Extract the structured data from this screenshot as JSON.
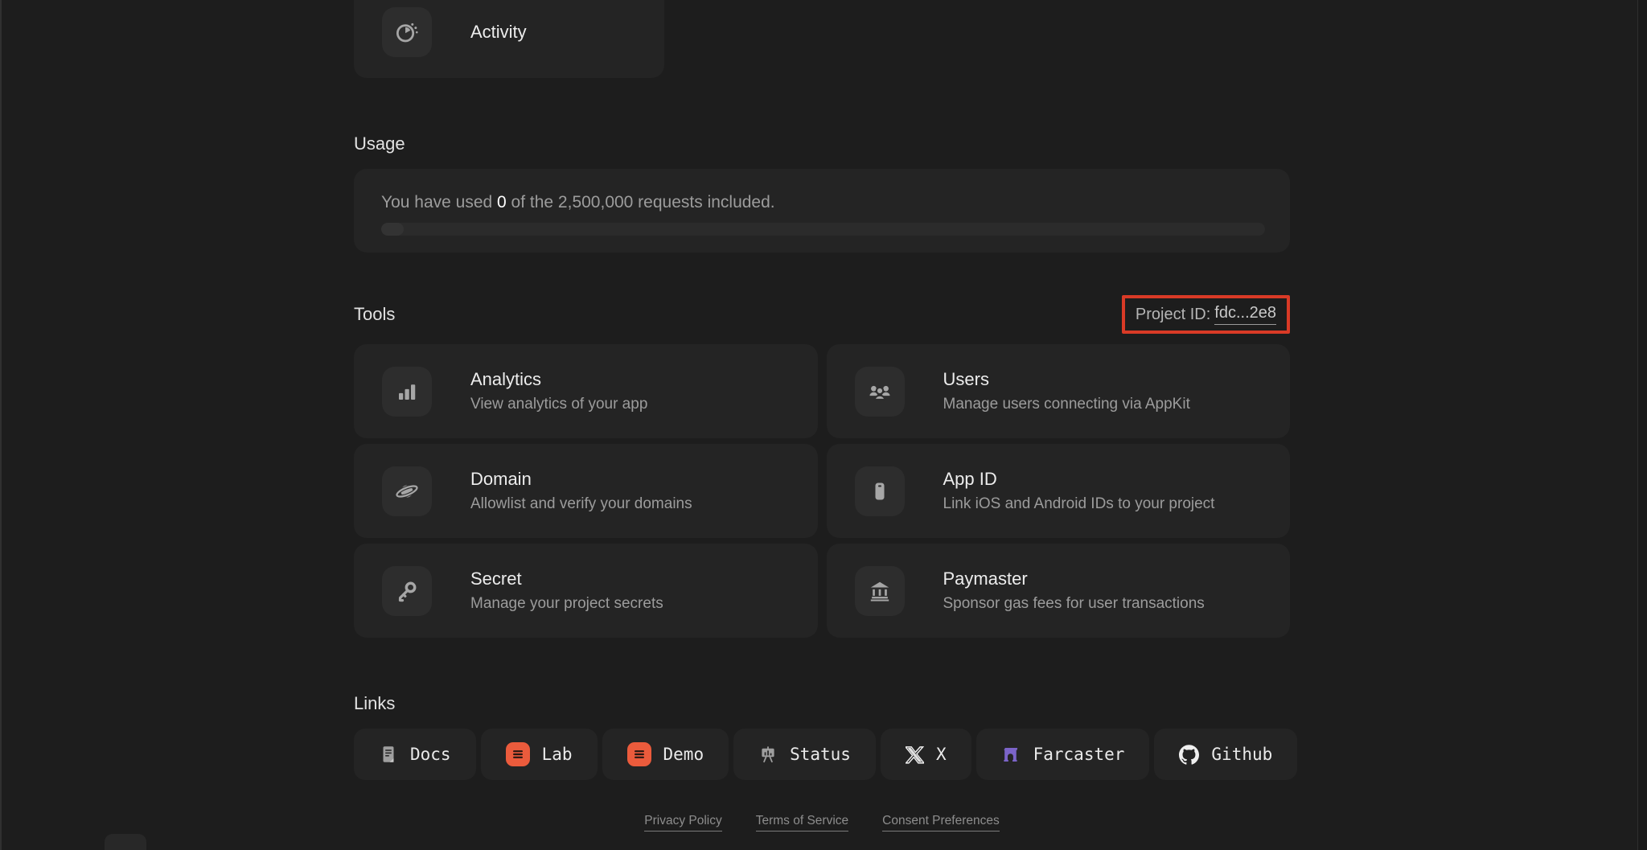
{
  "activity_card": {
    "label": "Activity"
  },
  "usage": {
    "heading": "Usage",
    "text_prefix": "You have used ",
    "used_value": "0",
    "text_suffix": " of the 2,500,000 requests included.",
    "progress_percent": 0
  },
  "tools": {
    "heading": "Tools",
    "project_id": {
      "label": "Project ID:",
      "value": "fdc...2e8",
      "highlight_color": "#d93a26"
    },
    "cards": [
      {
        "icon": "bar-chart-icon",
        "title": "Analytics",
        "description": "View analytics of your app"
      },
      {
        "icon": "users-icon",
        "title": "Users",
        "description": "Manage users connecting via AppKit"
      },
      {
        "icon": "planet-icon",
        "title": "Domain",
        "description": "Allowlist and verify your domains"
      },
      {
        "icon": "phone-icon",
        "title": "App ID",
        "description": "Link iOS and Android IDs to your project"
      },
      {
        "icon": "key-icon",
        "title": "Secret",
        "description": "Manage your project secrets"
      },
      {
        "icon": "bank-icon",
        "title": "Paymaster",
        "description": "Sponsor gas fees for user transactions"
      }
    ]
  },
  "links": {
    "heading": "Links",
    "items": [
      {
        "icon": "docs-icon",
        "label": "Docs"
      },
      {
        "icon": "lab-icon",
        "label": "Lab",
        "icon_color": "#eb5b3c"
      },
      {
        "icon": "demo-icon",
        "label": "Demo",
        "icon_color": "#eb5b3c"
      },
      {
        "icon": "status-icon",
        "label": "Status"
      },
      {
        "icon": "x-icon",
        "label": "X"
      },
      {
        "icon": "farcaster-icon",
        "label": "Farcaster",
        "icon_color": "#7b64c8"
      },
      {
        "icon": "github-icon",
        "label": "Github"
      }
    ]
  },
  "footer": {
    "links": [
      "Privacy Policy",
      "Terms of Service",
      "Consent Preferences"
    ]
  },
  "colors": {
    "page_background": "#1d1d1d",
    "card_background": "#242424",
    "icon_tile_background": "#2d2d2d",
    "primary_text": "#ededed",
    "secondary_text": "#9c9c9c",
    "annotation_red": "#d93a26",
    "brand_orange": "#eb5b3c",
    "farcaster_purple": "#7b64c8"
  }
}
